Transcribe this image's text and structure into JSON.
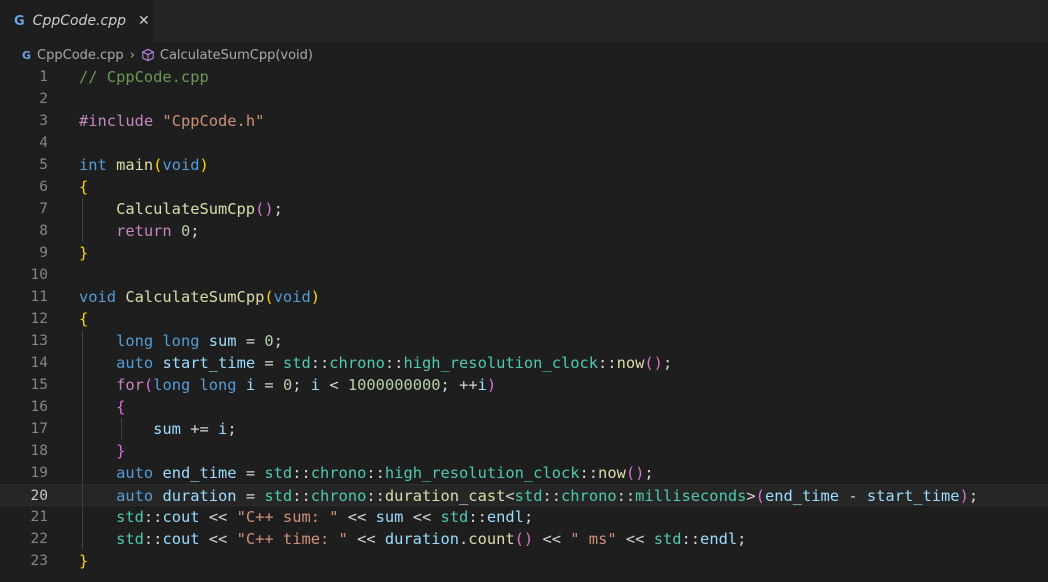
{
  "tab": {
    "icon": "cpp-file-icon",
    "icon_text": "G",
    "title": "CppCode.cpp",
    "close": "✕"
  },
  "breadcrumb": {
    "file": "CppCode.cpp",
    "separator": "›",
    "symbol": "CalculateSumCpp(void)"
  },
  "colors": {
    "editor_bg": "#1e1e1e",
    "tab_bar_bg": "#252526",
    "line_number": "#858585",
    "comment": "#6a9955",
    "keyword": "#569cd6",
    "control": "#c586c0",
    "function": "#dcdcaa",
    "string": "#ce9178",
    "number": "#b5cea8",
    "variable": "#9cdcfe",
    "type": "#4ec9b0"
  },
  "active_line": 20,
  "lines": [
    {
      "n": "1",
      "tokens": [
        [
          "comment",
          "// CppCode.cpp"
        ]
      ]
    },
    {
      "n": "2",
      "tokens": []
    },
    {
      "n": "3",
      "tokens": [
        [
          "control",
          "#include"
        ],
        [
          "plain",
          " "
        ],
        [
          "string",
          "\"CppCode.h\""
        ]
      ]
    },
    {
      "n": "4",
      "tokens": []
    },
    {
      "n": "5",
      "tokens": [
        [
          "keyword",
          "int"
        ],
        [
          "plain",
          " "
        ],
        [
          "function",
          "main"
        ],
        [
          "brace1",
          "("
        ],
        [
          "keyword",
          "void"
        ],
        [
          "brace1",
          ")"
        ]
      ]
    },
    {
      "n": "6",
      "tokens": [
        [
          "brace1",
          "{"
        ]
      ]
    },
    {
      "n": "7",
      "tokens": [
        [
          "plain",
          "    "
        ],
        [
          "function",
          "CalculateSumCpp"
        ],
        [
          "brace2",
          "()"
        ],
        [
          "plain",
          ";"
        ]
      ]
    },
    {
      "n": "8",
      "tokens": [
        [
          "plain",
          "    "
        ],
        [
          "control",
          "return"
        ],
        [
          "plain",
          " "
        ],
        [
          "number",
          "0"
        ],
        [
          "plain",
          ";"
        ]
      ]
    },
    {
      "n": "9",
      "tokens": [
        [
          "brace1",
          "}"
        ]
      ]
    },
    {
      "n": "10",
      "tokens": []
    },
    {
      "n": "11",
      "tokens": [
        [
          "keyword",
          "void"
        ],
        [
          "plain",
          " "
        ],
        [
          "function",
          "CalculateSumCpp"
        ],
        [
          "brace1",
          "("
        ],
        [
          "keyword",
          "void"
        ],
        [
          "brace1",
          ")"
        ]
      ]
    },
    {
      "n": "12",
      "tokens": [
        [
          "brace1",
          "{"
        ]
      ]
    },
    {
      "n": "13",
      "tokens": [
        [
          "plain",
          "    "
        ],
        [
          "keyword",
          "long long"
        ],
        [
          "plain",
          " "
        ],
        [
          "var",
          "sum"
        ],
        [
          "plain",
          " = "
        ],
        [
          "number",
          "0"
        ],
        [
          "plain",
          ";"
        ]
      ]
    },
    {
      "n": "14",
      "tokens": [
        [
          "plain",
          "    "
        ],
        [
          "keyword",
          "auto"
        ],
        [
          "plain",
          " "
        ],
        [
          "var",
          "start_time"
        ],
        [
          "plain",
          " = "
        ],
        [
          "type",
          "std"
        ],
        [
          "plain",
          "::"
        ],
        [
          "type",
          "chrono"
        ],
        [
          "plain",
          "::"
        ],
        [
          "type",
          "high_resolution_clock"
        ],
        [
          "plain",
          "::"
        ],
        [
          "function",
          "now"
        ],
        [
          "brace2",
          "()"
        ],
        [
          "plain",
          ";"
        ]
      ]
    },
    {
      "n": "15",
      "tokens": [
        [
          "plain",
          "    "
        ],
        [
          "control",
          "for"
        ],
        [
          "brace2",
          "("
        ],
        [
          "keyword",
          "long long"
        ],
        [
          "plain",
          " "
        ],
        [
          "var",
          "i"
        ],
        [
          "plain",
          " = "
        ],
        [
          "number",
          "0"
        ],
        [
          "plain",
          "; "
        ],
        [
          "var",
          "i"
        ],
        [
          "plain",
          " < "
        ],
        [
          "number",
          "1000000000"
        ],
        [
          "plain",
          "; ++"
        ],
        [
          "var",
          "i"
        ],
        [
          "brace2",
          ")"
        ]
      ]
    },
    {
      "n": "16",
      "tokens": [
        [
          "plain",
          "    "
        ],
        [
          "brace2",
          "{"
        ]
      ]
    },
    {
      "n": "17",
      "tokens": [
        [
          "plain",
          "        "
        ],
        [
          "var",
          "sum"
        ],
        [
          "plain",
          " += "
        ],
        [
          "var",
          "i"
        ],
        [
          "plain",
          ";"
        ]
      ]
    },
    {
      "n": "18",
      "tokens": [
        [
          "plain",
          "    "
        ],
        [
          "brace2",
          "}"
        ]
      ]
    },
    {
      "n": "19",
      "tokens": [
        [
          "plain",
          "    "
        ],
        [
          "keyword",
          "auto"
        ],
        [
          "plain",
          " "
        ],
        [
          "var",
          "end_time"
        ],
        [
          "plain",
          " = "
        ],
        [
          "type",
          "std"
        ],
        [
          "plain",
          "::"
        ],
        [
          "type",
          "chrono"
        ],
        [
          "plain",
          "::"
        ],
        [
          "type",
          "high_resolution_clock"
        ],
        [
          "plain",
          "::"
        ],
        [
          "function",
          "now"
        ],
        [
          "brace2",
          "()"
        ],
        [
          "plain",
          ";"
        ]
      ]
    },
    {
      "n": "20",
      "tokens": [
        [
          "plain",
          "    "
        ],
        [
          "keyword",
          "auto"
        ],
        [
          "plain",
          " "
        ],
        [
          "var",
          "duration"
        ],
        [
          "plain",
          " = "
        ],
        [
          "type",
          "std"
        ],
        [
          "plain",
          "::"
        ],
        [
          "type",
          "chrono"
        ],
        [
          "plain",
          "::"
        ],
        [
          "function",
          "duration_cast"
        ],
        [
          "plain",
          "<"
        ],
        [
          "type",
          "std"
        ],
        [
          "plain",
          "::"
        ],
        [
          "type",
          "chrono"
        ],
        [
          "plain",
          "::"
        ],
        [
          "type",
          "milliseconds"
        ],
        [
          "plain",
          ">"
        ],
        [
          "brace2",
          "("
        ],
        [
          "var",
          "end_time"
        ],
        [
          "plain",
          " - "
        ],
        [
          "var",
          "start_time"
        ],
        [
          "brace2",
          ")"
        ],
        [
          "plain",
          ";"
        ]
      ]
    },
    {
      "n": "21",
      "tokens": [
        [
          "plain",
          "    "
        ],
        [
          "type",
          "std"
        ],
        [
          "plain",
          "::"
        ],
        [
          "var",
          "cout"
        ],
        [
          "plain",
          " << "
        ],
        [
          "string",
          "\"C++ sum: \""
        ],
        [
          "plain",
          " << "
        ],
        [
          "var",
          "sum"
        ],
        [
          "plain",
          " << "
        ],
        [
          "type",
          "std"
        ],
        [
          "plain",
          "::"
        ],
        [
          "var",
          "endl"
        ],
        [
          "plain",
          ";"
        ]
      ]
    },
    {
      "n": "22",
      "tokens": [
        [
          "plain",
          "    "
        ],
        [
          "type",
          "std"
        ],
        [
          "plain",
          "::"
        ],
        [
          "var",
          "cout"
        ],
        [
          "plain",
          " << "
        ],
        [
          "string",
          "\"C++ time: \""
        ],
        [
          "plain",
          " << "
        ],
        [
          "var",
          "duration"
        ],
        [
          "plain",
          "."
        ],
        [
          "function",
          "count"
        ],
        [
          "brace2",
          "()"
        ],
        [
          "plain",
          " << "
        ],
        [
          "string",
          "\" ms\""
        ],
        [
          "plain",
          " << "
        ],
        [
          "type",
          "std"
        ],
        [
          "plain",
          "::"
        ],
        [
          "var",
          "endl"
        ],
        [
          "plain",
          ";"
        ]
      ]
    },
    {
      "n": "23",
      "tokens": [
        [
          "brace1",
          "}"
        ]
      ]
    }
  ]
}
